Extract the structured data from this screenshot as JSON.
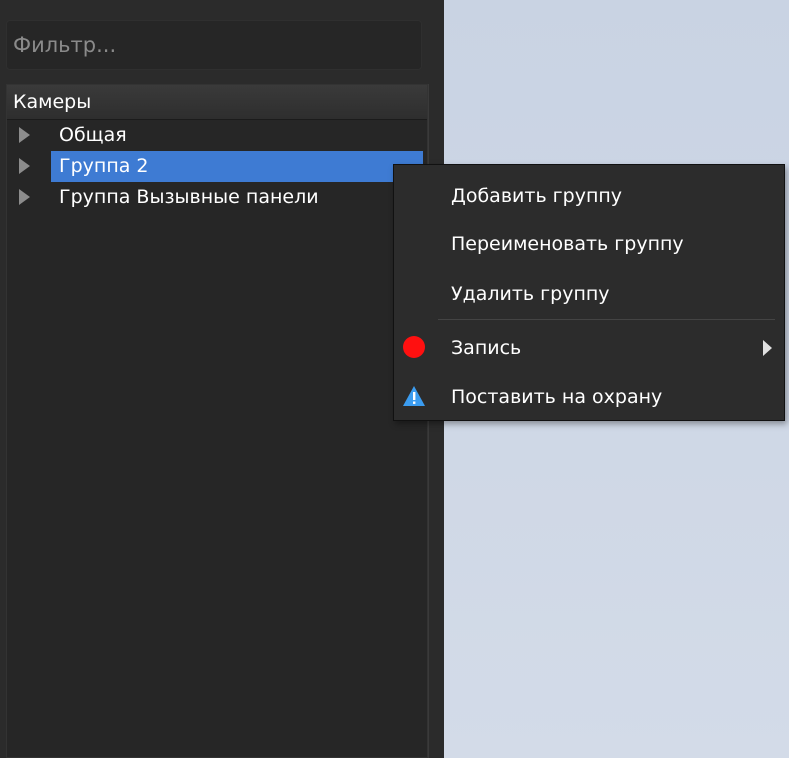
{
  "filter": {
    "placeholder": "Фильтр..."
  },
  "tree": {
    "header": "Камеры",
    "items": [
      {
        "label": "Общая",
        "selected": false
      },
      {
        "label": "Группа 2",
        "selected": true
      },
      {
        "label": "Группа Вызывные панели",
        "selected": false
      }
    ]
  },
  "context_menu": {
    "items": [
      {
        "label": "Добавить группу"
      },
      {
        "label": "Переименовать группу"
      },
      {
        "label": "Удалить группу"
      },
      {
        "label": "Запись",
        "icon": "record-icon",
        "has_submenu": true
      },
      {
        "label": "Поставить на охрану",
        "icon": "warning-icon"
      }
    ]
  },
  "colors": {
    "selection": "#3e7bd3",
    "record": "#ff1010",
    "warning": "#3b9cf0",
    "panel_bg": "#2b2b2b",
    "workspace_bg": "#d3dbe7"
  }
}
